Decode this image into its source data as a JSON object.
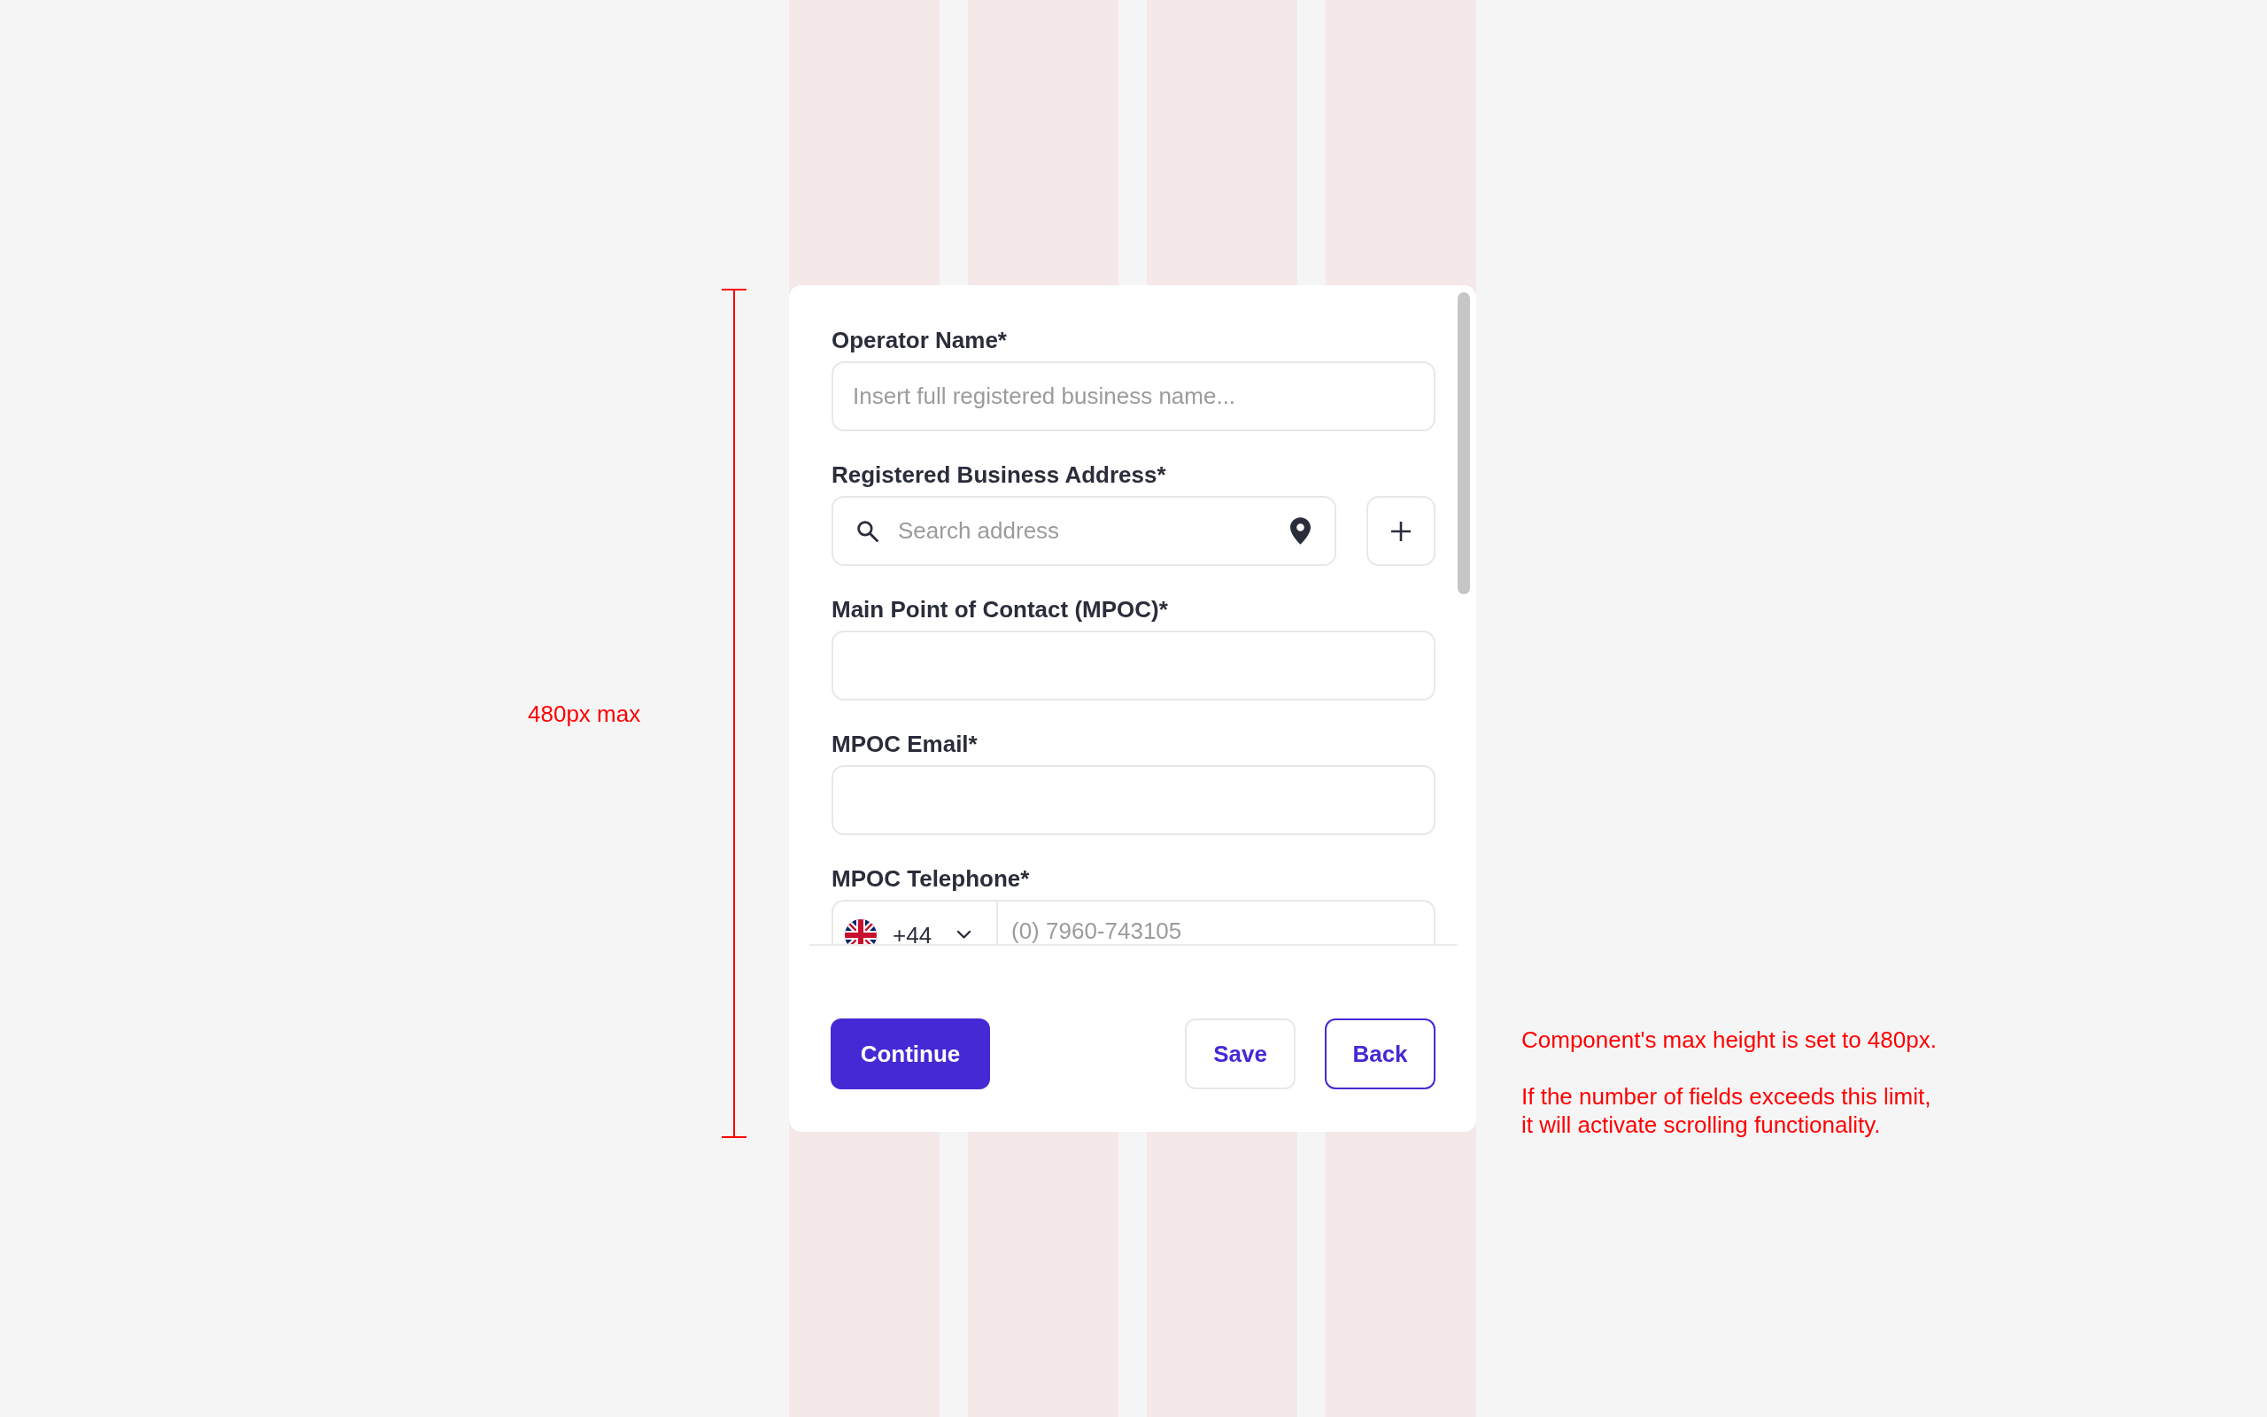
{
  "annotations": {
    "height_label": "480px max",
    "notes": [
      "Component's max height is set to 480px.",
      "If the number of fields exceeds this limit,\nit will activate scrolling functionality."
    ]
  },
  "form": {
    "fields": [
      {
        "kind": "text",
        "label": "Operator Name*",
        "placeholder": "Insert full registered business name..."
      },
      {
        "kind": "address",
        "label": "Registered Business Address*",
        "placeholder": "Search address"
      },
      {
        "kind": "text",
        "label": "Main Point of Contact (MPOC)*"
      },
      {
        "kind": "text",
        "label": "MPOC Email*"
      },
      {
        "kind": "phone",
        "label": "MPOC Telephone*",
        "country_code": "+44",
        "placeholder": "(0) 7960-743105"
      }
    ],
    "buttons": [
      {
        "kind": "primary",
        "label": "Continue"
      },
      {
        "kind": "secondary",
        "label": "Save"
      },
      {
        "kind": "outline",
        "label": "Back"
      }
    ]
  }
}
